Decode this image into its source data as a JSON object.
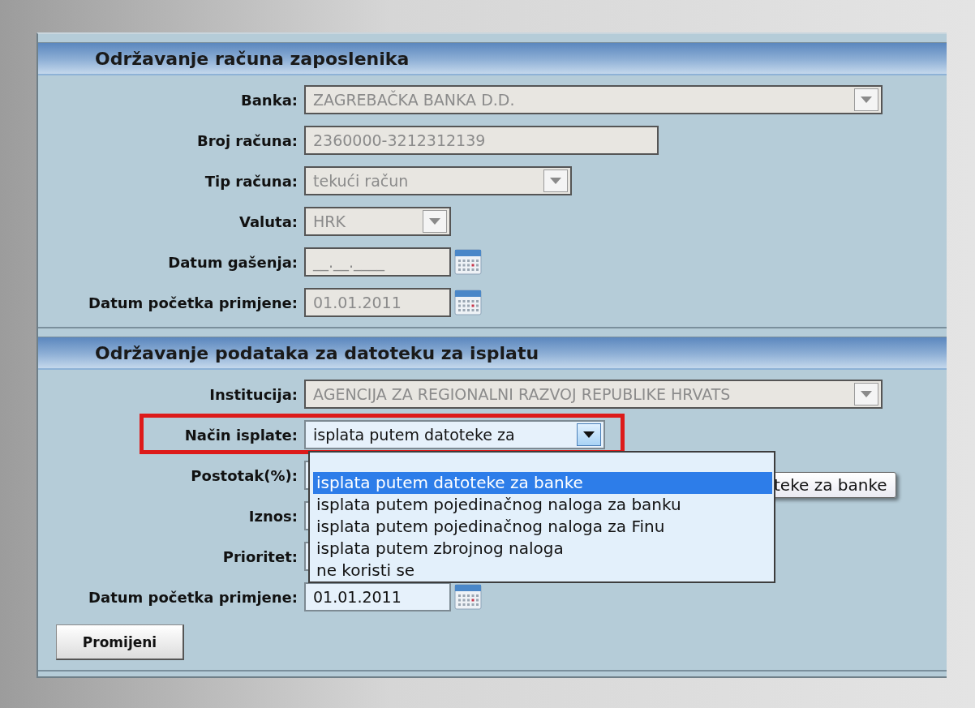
{
  "sections": [
    {
      "title": "Održavanje računa zaposlenika",
      "fields": [
        {
          "label": "Banka:",
          "kind": "select",
          "value": "ZAGREBAČKA BANKA D.D.",
          "disabled": true
        },
        {
          "label": "Broj računa:",
          "kind": "text",
          "value": "2360000-3212312139",
          "disabled": true
        },
        {
          "label": "Tip računa:",
          "kind": "select",
          "value": "tekući račun",
          "disabled": true
        },
        {
          "label": "Valuta:",
          "kind": "select",
          "value": "HRK",
          "disabled": true
        },
        {
          "label": "Datum gašenja:",
          "kind": "date",
          "value": "__.__.____",
          "disabled": true
        },
        {
          "label": "Datum početka primjene:",
          "kind": "date",
          "value": "01.01.2011",
          "disabled": true
        }
      ]
    },
    {
      "title": "Održavanje podataka za datoteku za isplatu",
      "fields": [
        {
          "label": "Institucija:",
          "kind": "select",
          "value": "AGENCIJA ZA REGIONALNI RAZVOJ REPUBLIKE HRVATS",
          "disabled": true
        },
        {
          "label": "Način isplate:",
          "kind": "select",
          "value": "isplata putem datoteke za",
          "disabled": false,
          "highlighted": true,
          "expanded": true,
          "options": [
            {
              "label": "isplata putem datoteke za banke",
              "selected": true
            },
            {
              "label": "isplata putem pojedinačnog naloga za banku",
              "selected": false
            },
            {
              "label": "isplata putem pojedinačnog naloga za Finu",
              "selected": false
            },
            {
              "label": "isplata putem zbrojnog naloga",
              "selected": false
            },
            {
              "label": "ne koristi se",
              "selected": false
            }
          ],
          "tooltip": "teke za banke"
        },
        {
          "label": "Postotak(%):",
          "kind": "text"
        },
        {
          "label": "Iznos:",
          "kind": "text"
        },
        {
          "label": "Prioritet:",
          "kind": "text"
        },
        {
          "label": "Datum početka primjene:",
          "kind": "date",
          "value": "01.01.2011",
          "disabled": false
        }
      ],
      "button": "Promijeni"
    }
  ]
}
